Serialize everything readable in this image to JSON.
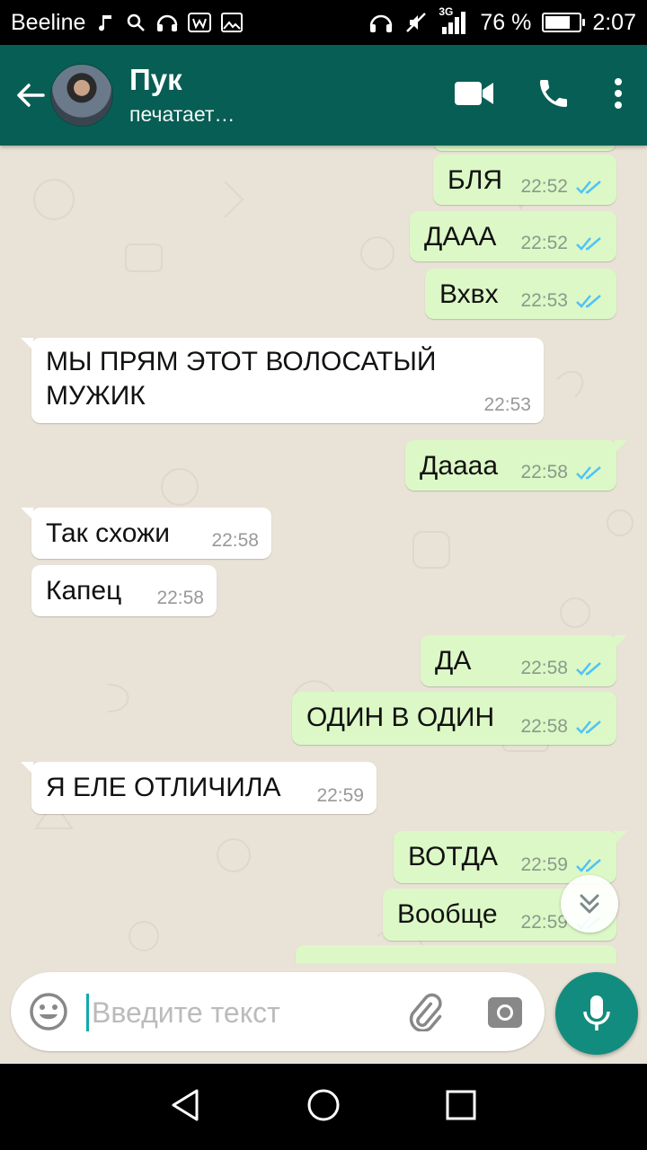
{
  "status_bar": {
    "carrier": "Beeline",
    "network": "3G",
    "battery": "76 %",
    "battery_level": 0.76,
    "time": "2:07"
  },
  "header": {
    "contact_name": "Пук",
    "contact_status": "печатает…"
  },
  "messages": [
    {
      "direction": "out",
      "text": "БЛЯ",
      "time": "22:52",
      "read": true
    },
    {
      "direction": "out",
      "text": "ДААА",
      "time": "22:52",
      "read": true
    },
    {
      "direction": "out",
      "text": "Вхвх",
      "time": "22:53",
      "read": true
    },
    {
      "direction": "in",
      "text_line1": "МЫ ПРЯМ ЭТОТ ВОЛОСАТЫЙ",
      "text_line2": "МУЖИК",
      "time": "22:53"
    },
    {
      "direction": "out",
      "text": "Даааа",
      "time": "22:58",
      "read": true
    },
    {
      "direction": "in",
      "text": "Так схожи",
      "time": "22:58"
    },
    {
      "direction": "in",
      "text": "Капец",
      "time": "22:58"
    },
    {
      "direction": "out",
      "text": "ДА",
      "time": "22:58",
      "read": true
    },
    {
      "direction": "out",
      "text": "ОДИН В ОДИН",
      "time": "22:58",
      "read": true
    },
    {
      "direction": "in",
      "text": "Я ЕЛЕ ОТЛИЧИЛА",
      "time": "22:59"
    },
    {
      "direction": "out",
      "text": "ВОТДА",
      "time": "22:59",
      "read": true
    },
    {
      "direction": "out",
      "text": "Вообще",
      "time": "22:59",
      "read": true
    }
  ],
  "composer": {
    "placeholder": "Введите текст"
  },
  "colors": {
    "header": "#075e54",
    "outgoing_bubble": "#dcf8c6",
    "incoming_bubble": "#ffffff",
    "read_ticks": "#4fc3f7",
    "mic_button": "#128c7e",
    "chat_background": "#e9e2d6"
  },
  "icons": [
    "back-arrow-icon",
    "video-call-icon",
    "phone-icon",
    "more-vert-icon",
    "emoji-icon",
    "attach-icon",
    "camera-icon",
    "mic-icon",
    "scroll-down-icon",
    "nav-back-icon",
    "nav-home-icon",
    "nav-recents-icon"
  ]
}
